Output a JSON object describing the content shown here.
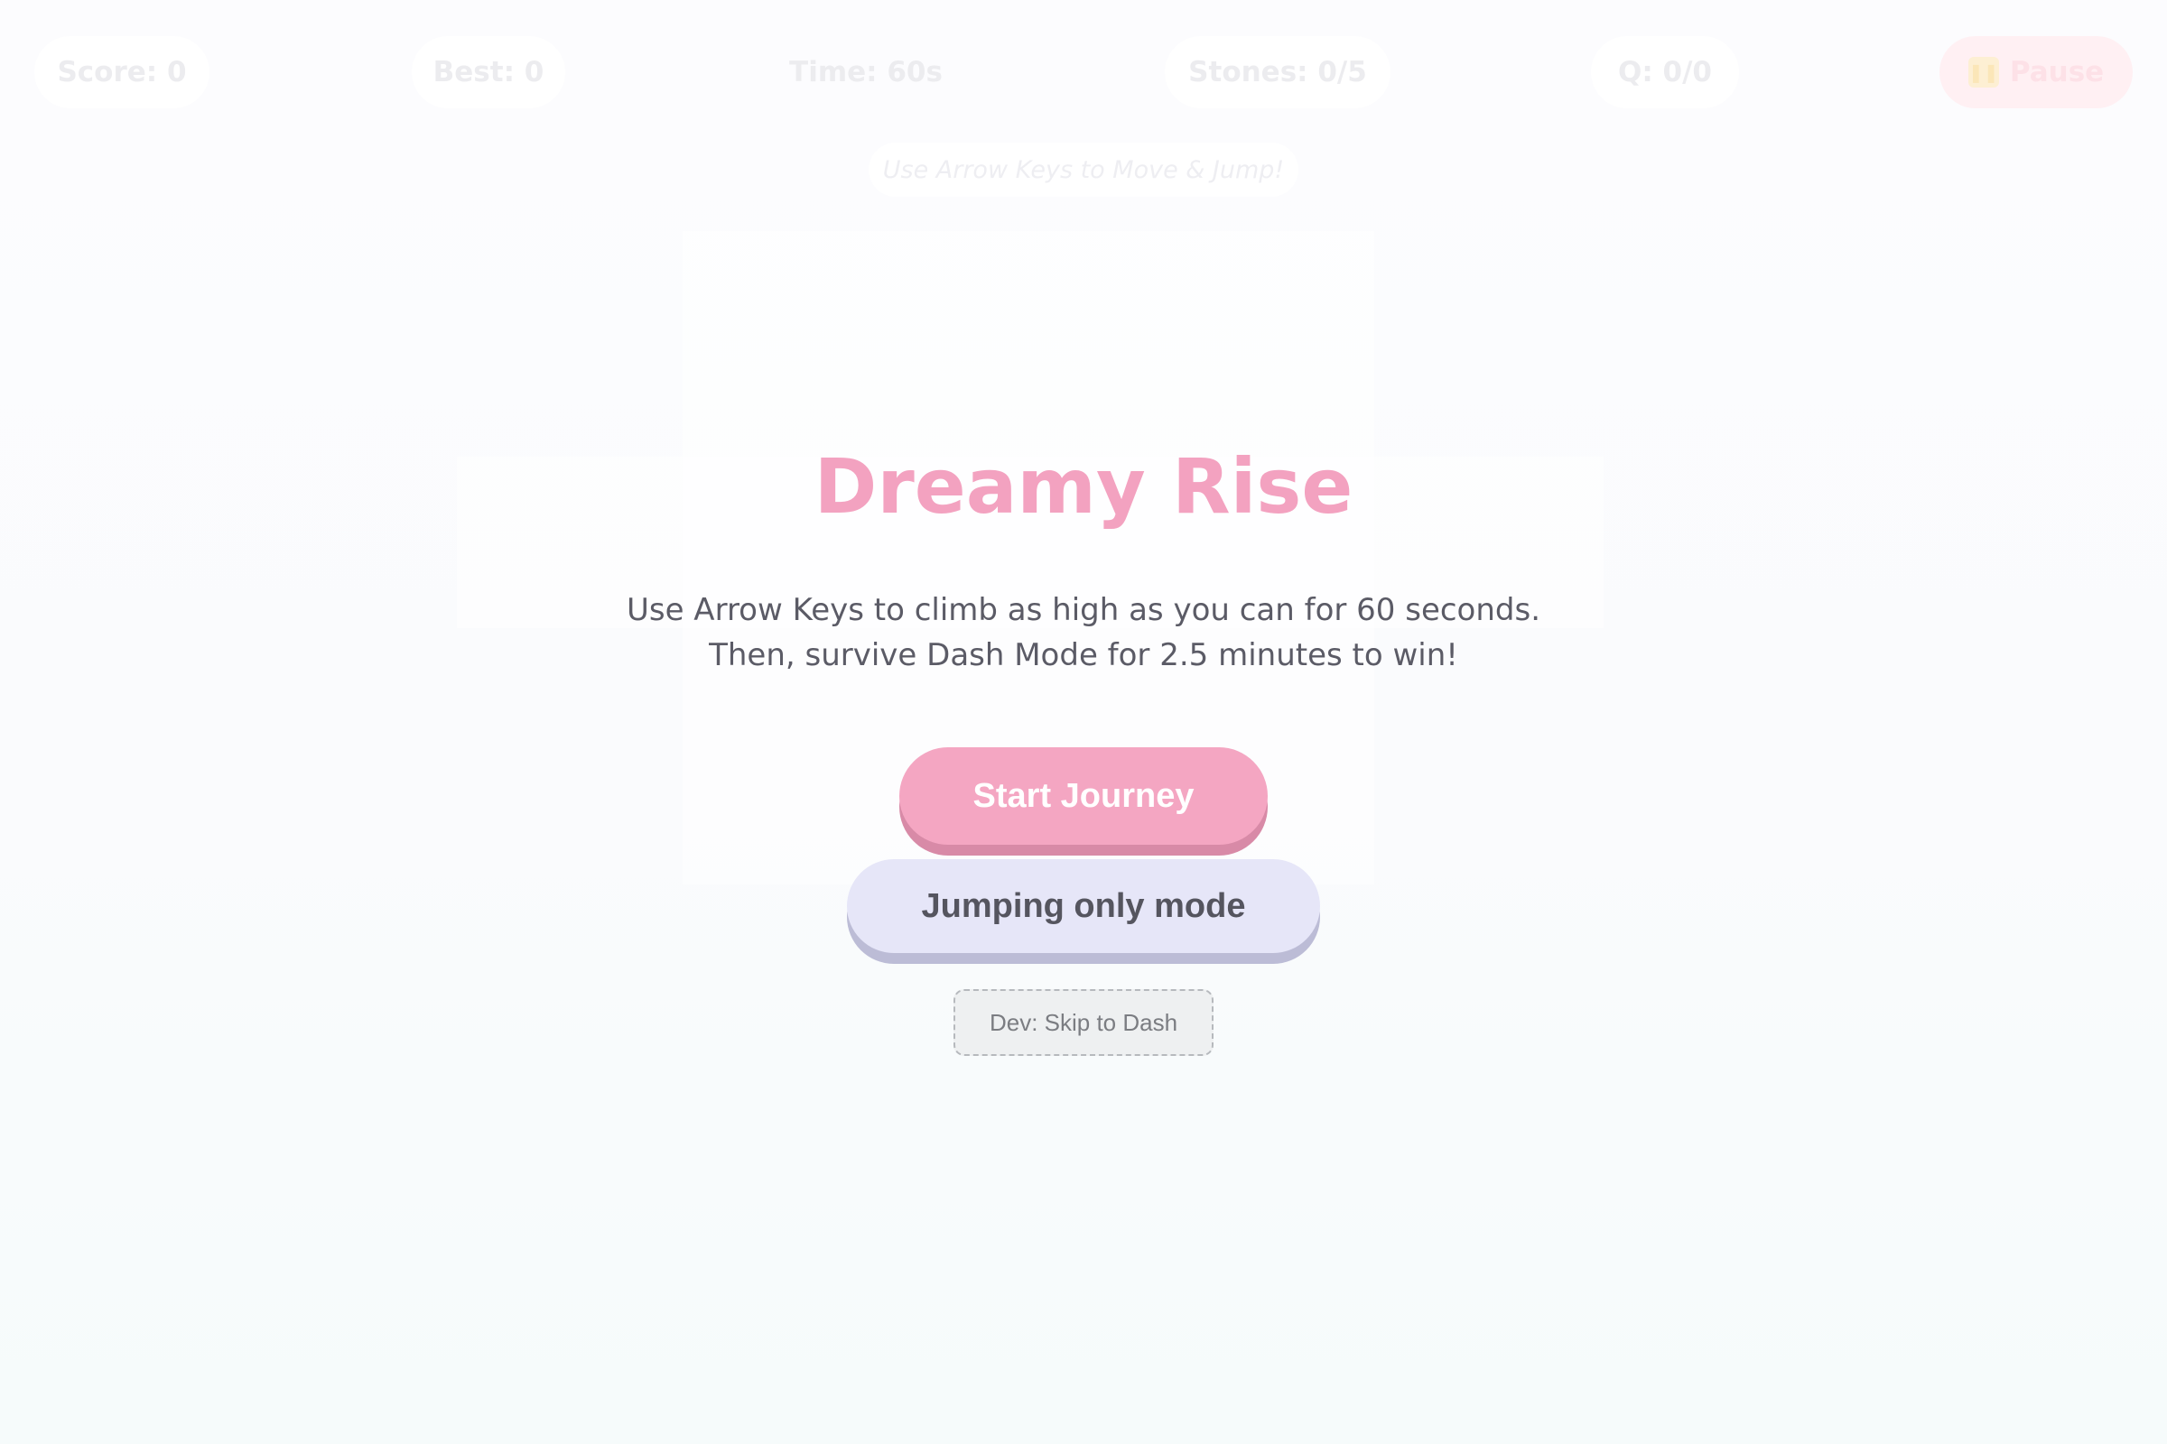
{
  "hud": {
    "score": "Score: 0",
    "best": "Best: 0",
    "time": "Time: 60s",
    "stones": "Stones: 0/5",
    "questions": "Q: 0/0",
    "pause_label": "Pause",
    "pause_icon": "pause-icon"
  },
  "hint": "Use Arrow Keys to Move & Jump!",
  "overlay": {
    "title": "Dreamy Rise",
    "description_line1": "Use Arrow Keys to climb as high as you can for 60 seconds.",
    "description_line2": "Then, survive Dash Mode for 2.5 minutes to win!",
    "start_button": "Start Journey",
    "jumping_mode_button": "Jumping only mode",
    "dev_button": "Dev: Skip to Dash"
  },
  "colors": {
    "title": "#f3a2c0",
    "start_button_bg": "#f4a6c2",
    "start_button_shadow": "#d88aa7",
    "jump_button_bg": "#e6e6f8",
    "jump_button_shadow": "#bcbcd6",
    "dev_button_bg": "#eef0f1",
    "text": "#5b5b66"
  }
}
